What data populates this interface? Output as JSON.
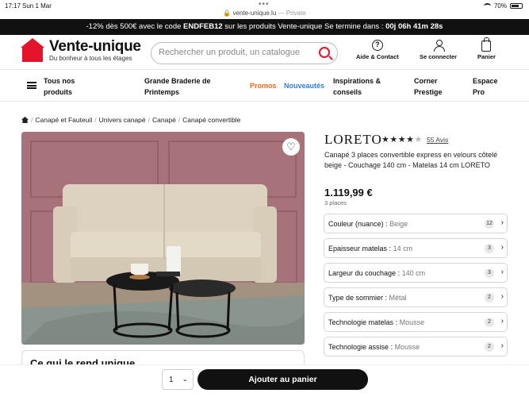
{
  "status": {
    "time": "17:17",
    "date": "Sun 1 Mar",
    "url": "vente-unique.lu",
    "private": "— Private",
    "battery": "70%"
  },
  "promo": {
    "text_a": "-12% dès 500€ avec le code ",
    "code": "ENDFEB12",
    "text_b": " sur les produits Vente-unique Se termine dans : ",
    "timer": "00j 06h 41m 28s"
  },
  "header": {
    "brand": "Vente-unique",
    "tagline": "Du bonheur à tous les étages",
    "search_placeholder": "Rechercher un produit, un catalogue",
    "help": "Aide & Contact",
    "login": "Se connecter",
    "cart": "Panier"
  },
  "nav": {
    "all": [
      "Tous nos",
      "produits"
    ],
    "braderie": [
      "Grande Braderie de",
      "Printemps"
    ],
    "promos": "Promos",
    "nouveautes": "Nouveautés",
    "inspirations": [
      "Inspirations &",
      "conseils"
    ],
    "corner": [
      "Corner",
      "Prestige"
    ],
    "pro": [
      "Espace",
      "Pro"
    ]
  },
  "breadcrumb": [
    "Canapé et Fauteuil",
    "Univers canapé",
    "Canapé",
    "Canapé convertible"
  ],
  "product": {
    "name": "LORETO",
    "rating": 4,
    "reviews": "55 Avis",
    "description": "Canapé 3 places convertible express en velours côtelé beige - Couchage 140 cm - Matelas 14 cm LORETO",
    "price": "1.119,99 €",
    "places": "3 places",
    "options": [
      {
        "label": "Couleur (nuance)",
        "value": "Beige",
        "count": "12"
      },
      {
        "label": "Epaisseur matelas",
        "value": "14 cm",
        "count": "3"
      },
      {
        "label": "Largeur du couchage",
        "value": "140 cm",
        "count": "3"
      },
      {
        "label": "Type de sommier",
        "value": "Métal",
        "count": "2"
      },
      {
        "label": "Technologie matelas",
        "value": "Mousse",
        "count": "2"
      },
      {
        "label": "Technologie assise",
        "value": "Mousse",
        "count": "2"
      }
    ]
  },
  "section_title": "Ce qui le rend unique",
  "bottom": {
    "qty": "1",
    "add_label": "Ajouter au panier"
  },
  "colors": {
    "brand_red": "#e5142a",
    "promos_orange": "#f06a1f",
    "nouveautes_blue": "#2f7ee0"
  }
}
